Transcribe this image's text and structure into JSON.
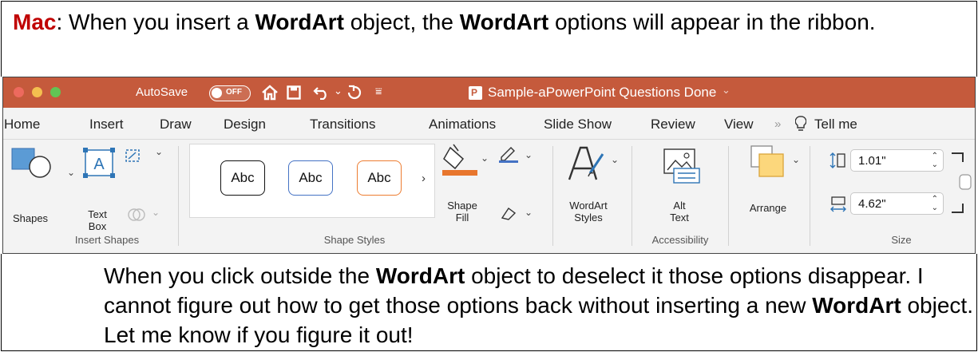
{
  "intro": {
    "label": "Mac",
    "t1": ": When you insert a ",
    "b1": "WordArt",
    "t2": " object, the ",
    "b2": "WordArt",
    "t3": " options will appear in the ribbon."
  },
  "window": {
    "autosave_label": "AutoSave",
    "autosave_state": "OFF",
    "doc_icon_letter": "P",
    "title": "Sample-aPowerPoint Questions Done",
    "colors": {
      "titlebar": "#c55a3c",
      "close": "#ed6a5e",
      "minimize": "#f4bf4f",
      "zoom": "#61c554"
    }
  },
  "tabs": [
    "Home",
    "Insert",
    "Draw",
    "Design",
    "Transitions",
    "Animations",
    "Slide Show",
    "Review",
    "View",
    "Tell me"
  ],
  "ribbon": {
    "shapes_label": "Shapes",
    "textbox_label": [
      "Text",
      "Box"
    ],
    "insert_shapes_group": "Insert Shapes",
    "style_thumbs": [
      "Abc",
      "Abc",
      "Abc"
    ],
    "shape_fill_label": [
      "Shape",
      "Fill"
    ],
    "shape_styles_group": "Shape Styles",
    "wordart_styles_label": [
      "WordArt",
      "Styles"
    ],
    "alt_text_label": [
      "Alt",
      "Text"
    ],
    "accessibility_group": "Accessibility",
    "arrange_label": "Arrange",
    "height_value": "1.01\"",
    "width_value": "4.62\"",
    "size_group": "Size",
    "accent_orange": "#e8762d"
  },
  "outro": {
    "t1": "When you click outside the ",
    "b1": "WordArt",
    "t2": " object to deselect it those options disappear. I cannot figure out how to get those options back without inserting a new ",
    "b2": "WordArt",
    "t3": " object. Let me know if you figure it out!"
  }
}
